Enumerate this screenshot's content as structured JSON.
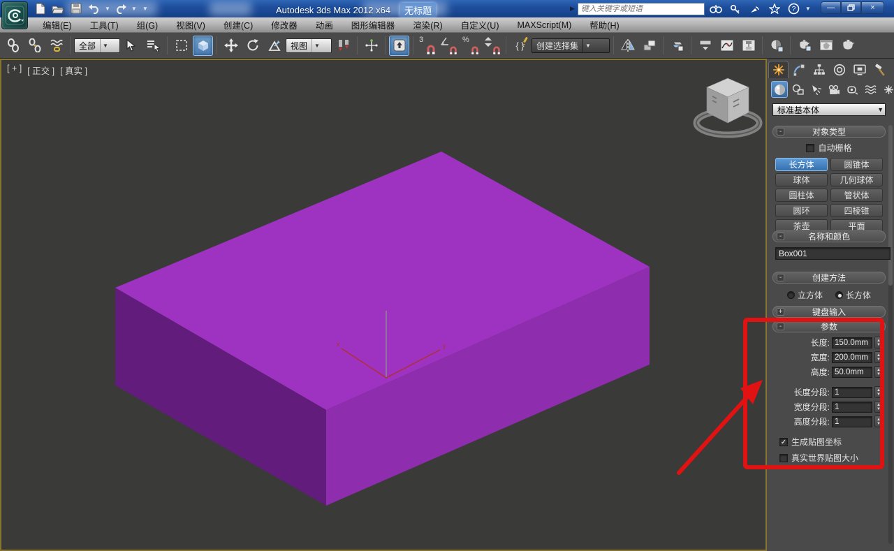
{
  "title_bar": {
    "app_title": "Autodesk 3ds Max  2012 x64",
    "doc_title": "无标题",
    "search_placeholder": "键入关键字或短语"
  },
  "menu_bar": {
    "items": [
      "编辑(E)",
      "工具(T)",
      "组(G)",
      "视图(V)",
      "创建(C)",
      "修改器",
      "动画",
      "图形编辑器",
      "渲染(R)",
      "自定义(U)",
      "MAXScript(M)",
      "帮助(H)"
    ]
  },
  "toolbar": {
    "selection_filter_value": "全部",
    "reference_coord_value": "视图",
    "named_sets_value": "创建选择集",
    "snap3_label": "3",
    "percent_label": "%"
  },
  "viewport": {
    "label_plus": "[ + ]",
    "label_pov": "[ 正交 ]",
    "label_shading": "[ 真实 ]"
  },
  "command_panel": {
    "primitive_dropdown_value": "标准基本体",
    "object_type": {
      "title": "对象类型",
      "autogrid_label": "自动栅格",
      "buttons": [
        "长方体",
        "圆锥体",
        "球体",
        "几何球体",
        "圆柱体",
        "管状体",
        "圆环",
        "四棱锥",
        "茶壶",
        "平面"
      ]
    },
    "name_color": {
      "title": "名称和颜色",
      "name_value": "Box001",
      "object_color": "#7a00a2"
    },
    "creation_method": {
      "title": "创建方法",
      "option_cube": "立方体",
      "option_box": "长方体"
    },
    "keyboard_entry": {
      "title": "键盘输入"
    },
    "parameters": {
      "title": "参数",
      "length_label": "长度:",
      "length_value": "150.0mm",
      "width_label": "宽度:",
      "width_value": "200.0mm",
      "height_label": "高度:",
      "height_value": "50.0mm",
      "length_segs_label": "长度分段:",
      "length_segs_value": "1",
      "width_segs_label": "宽度分段:",
      "width_segs_value": "1",
      "height_segs_label": "高度分段:",
      "height_segs_value": "1",
      "gen_mapping_label": "生成贴图坐标",
      "gen_mapping_check": "✓",
      "real_world_label": "真实世界贴图大小"
    }
  },
  "colors": {
    "box_top": "#9e33c2",
    "box_left": "#621c7c",
    "box_right": "#8e2dad",
    "annotation_red": "#e01212",
    "viewport_bg": "#3a3a38",
    "active_border_yellow": "#877431",
    "accent_blue": "#3f7fc1"
  }
}
